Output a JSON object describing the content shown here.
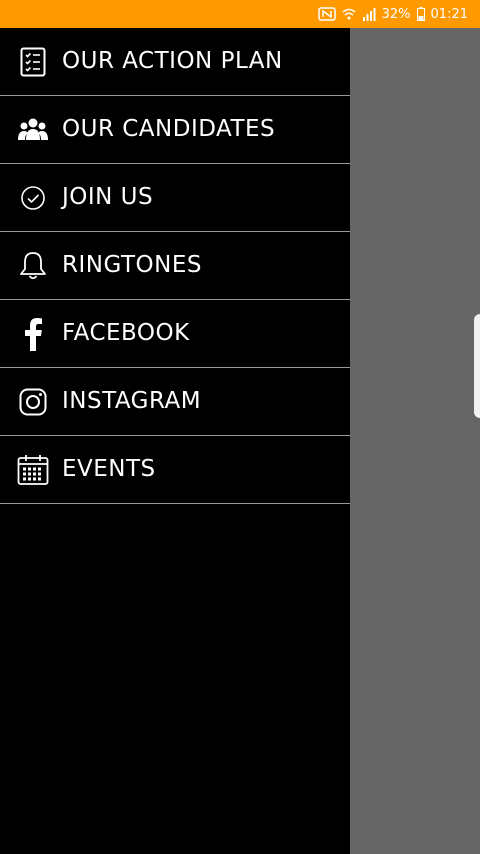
{
  "status_bar": {
    "battery_percent": "32%",
    "time": "01:21",
    "background": "#FF9900",
    "icons": [
      "nfc-icon",
      "wifi-icon",
      "signal-icon",
      "battery-icon"
    ]
  },
  "drawer": {
    "items": [
      {
        "label": "OUR ACTION PLAN",
        "icon": "checklist-icon"
      },
      {
        "label": "OUR CANDIDATES",
        "icon": "people-icon"
      },
      {
        "label": "JOIN US",
        "icon": "check-circle-icon"
      },
      {
        "label": "RINGTONES",
        "icon": "bell-icon"
      },
      {
        "label": "FACEBOOK",
        "icon": "facebook-icon"
      },
      {
        "label": "INSTAGRAM",
        "icon": "instagram-icon"
      },
      {
        "label": "EVENTS",
        "icon": "calendar-icon"
      }
    ]
  },
  "colors": {
    "drawer_bg": "#000000",
    "scrim": "#666666",
    "divider": "#9a9a9a",
    "text": "#ffffff"
  }
}
